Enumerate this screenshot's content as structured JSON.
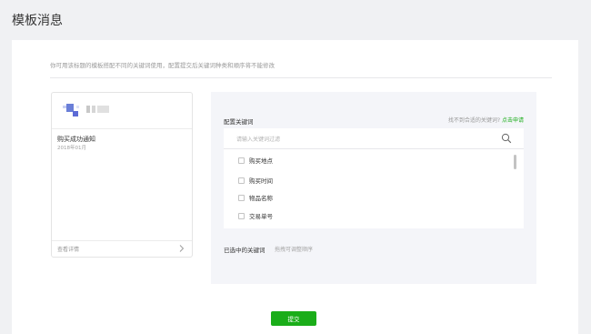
{
  "page": {
    "title": "模板消息",
    "intro": "你可用该标题的模板搭配不同的关键词使用，配置提交后关键词种类和顺序将不能修改"
  },
  "preview": {
    "template_title": "购买成功通知",
    "date": "2018年01月",
    "detail_label": "查看详情"
  },
  "config": {
    "title": "配置关键词",
    "hint_text": "找不到合适的关键词?",
    "hint_link": "点击申请",
    "search_placeholder": "请输入关键词过滤",
    "keywords": [
      "购买地点",
      "购买时间",
      "物品名称",
      "交易单号"
    ],
    "selected_label": "已选中的关键词",
    "selected_hint": "拖拽可调整顺序"
  },
  "actions": {
    "submit_label": "提交"
  },
  "colors": {
    "accent": "#1aad19",
    "logo_blue": "#5d6bd6"
  }
}
